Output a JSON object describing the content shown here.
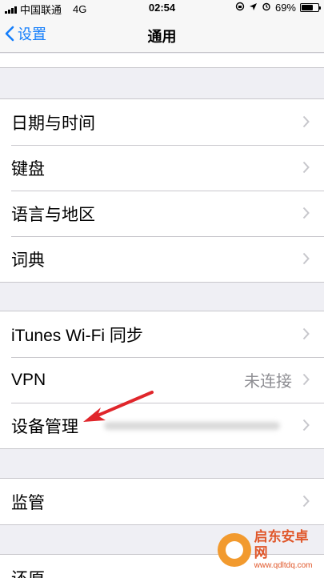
{
  "status_bar": {
    "carrier": "中国联通",
    "network": "4G",
    "time": "02:54",
    "battery": "69%",
    "battery_level": 0.69
  },
  "nav": {
    "back_label": "设置",
    "title": "通用"
  },
  "group1": {
    "items": [
      {
        "label": "日期与时间"
      },
      {
        "label": "键盘"
      },
      {
        "label": "语言与地区"
      },
      {
        "label": "词典"
      }
    ]
  },
  "group2": {
    "items": [
      {
        "label": "iTunes Wi-Fi 同步"
      },
      {
        "label": "VPN",
        "value": "未连接"
      },
      {
        "label": "设备管理"
      }
    ]
  },
  "group3": {
    "items": [
      {
        "label": "监管"
      }
    ]
  },
  "group4": {
    "items": [
      {
        "label": "还原"
      }
    ]
  },
  "watermark": {
    "title": "启东安卓网",
    "url": "www.qdltdq.com"
  },
  "colors": {
    "accent": "#147efb",
    "arrow": "#e0262b"
  }
}
